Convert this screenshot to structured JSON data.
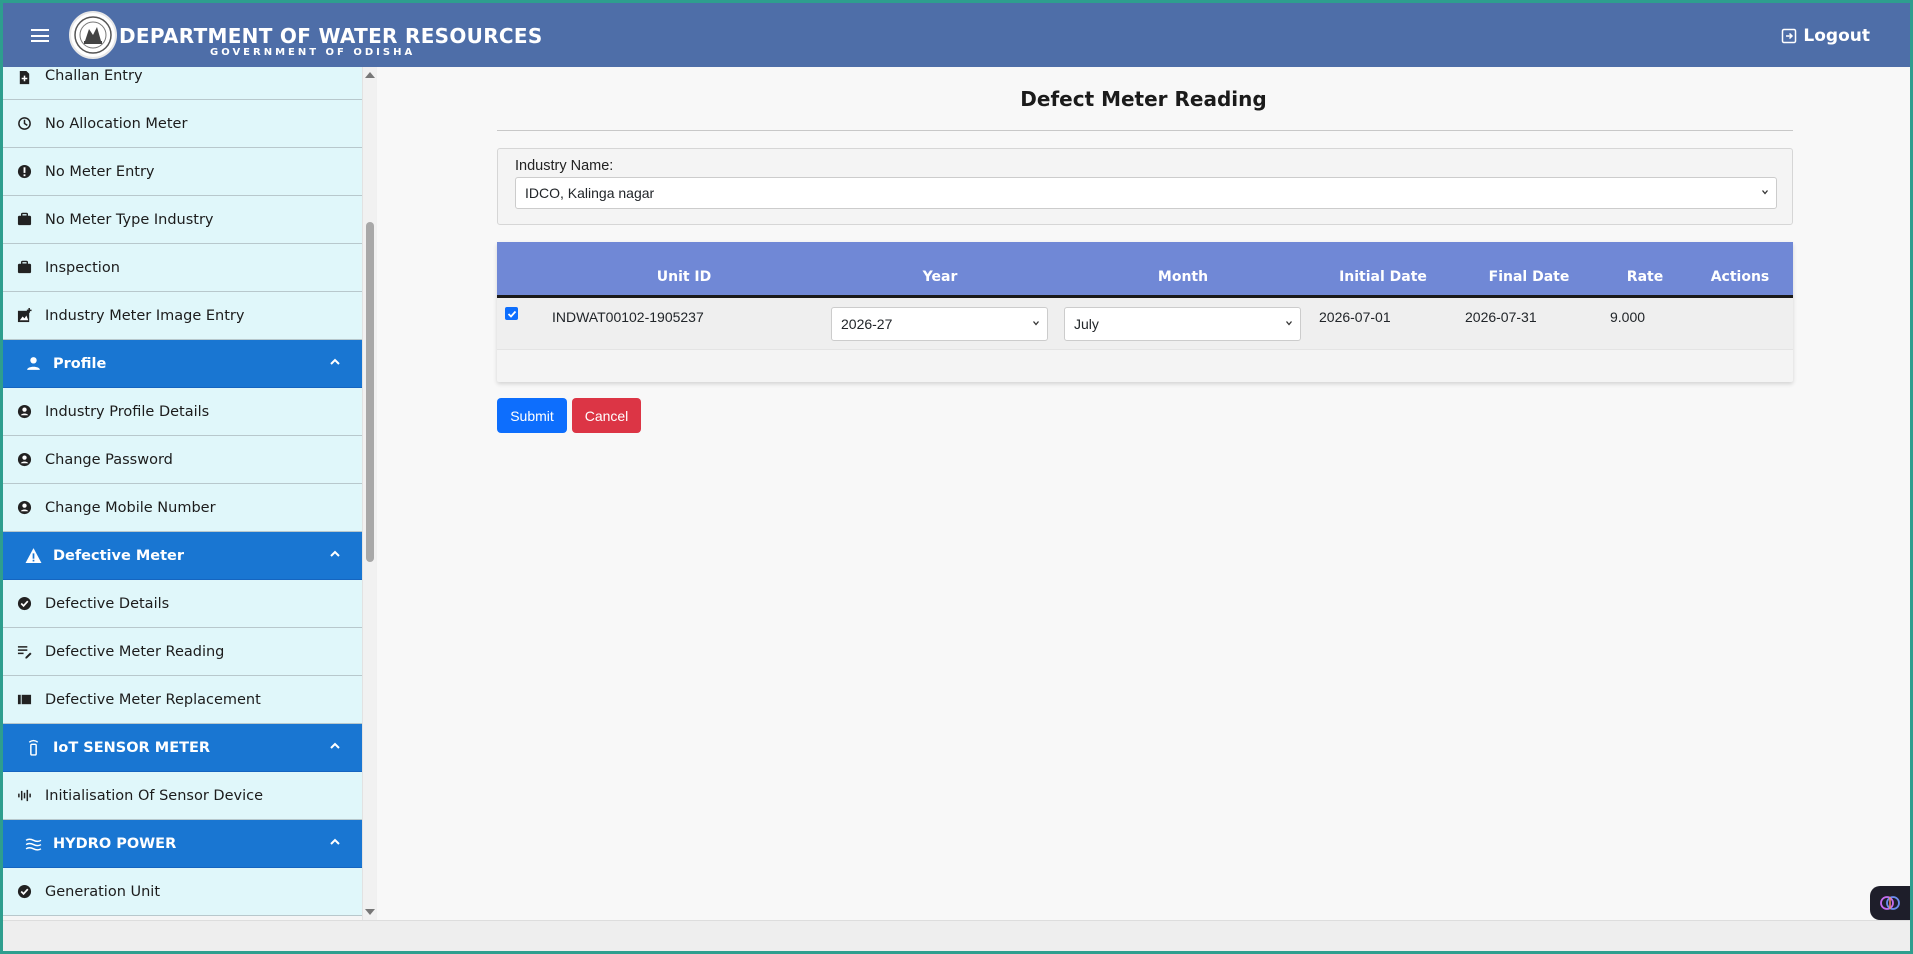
{
  "header": {
    "title": "DEPARTMENT OF WATER RESOURCES",
    "subtitle": "GOVERNMENT OF ODISHA",
    "logout_label": "Logout",
    "bg_color": "#4e6ea8"
  },
  "sidebar": {
    "items": [
      {
        "label": "Challan Entry",
        "icon": "file-plus-icon"
      },
      {
        "label": "No Allocation Meter",
        "icon": "timer-icon"
      },
      {
        "label": "No Meter Entry",
        "icon": "alert-circle-icon"
      },
      {
        "label": "No Meter Type Industry",
        "icon": "briefcase-icon"
      },
      {
        "label": "Inspection",
        "icon": "briefcase-icon"
      },
      {
        "label": "Industry Meter Image Entry",
        "icon": "image-plus-icon"
      },
      {
        "label": "Profile",
        "icon": "person-icon",
        "section": true
      },
      {
        "label": "Industry Profile Details",
        "icon": "account-circle-icon"
      },
      {
        "label": "Change Password",
        "icon": "account-circle-icon"
      },
      {
        "label": "Change Mobile Number",
        "icon": "account-circle-icon"
      },
      {
        "label": "Defective Meter",
        "icon": "warning-icon",
        "section": true
      },
      {
        "label": "Defective Details",
        "icon": "check-circle-icon"
      },
      {
        "label": "Defective Meter Reading",
        "icon": "edit-note-icon"
      },
      {
        "label": "Defective Meter Replacement",
        "icon": "list-icon"
      },
      {
        "label": "IoT SENSOR METER",
        "icon": "sensor-icon",
        "section": true
      },
      {
        "label": "Initialisation Of Sensor Device",
        "icon": "waveform-icon"
      },
      {
        "label": "HYDRO POWER",
        "icon": "waves-icon",
        "section": true
      },
      {
        "label": "Generation Unit",
        "icon": "check-circle-icon"
      }
    ],
    "section_color": "#1976d2",
    "item_bg": "#e0f7fa"
  },
  "main": {
    "title": "Defect Meter Reading",
    "filter": {
      "label": "Industry Name:",
      "selected": "IDCO, Kalinga nagar"
    },
    "table": {
      "header_color": "#7088d6",
      "columns": [
        "Unit ID",
        "Year",
        "Month",
        "Initial Date",
        "Final Date",
        "Rate",
        "Actions"
      ],
      "rows": [
        {
          "checked": true,
          "unit_id": "INDWAT00102-1905237",
          "year": "2026-27",
          "month": "July",
          "initial_date": "2026-07-01",
          "final_date": "2026-07-31",
          "rate": "9.000",
          "actions": ""
        }
      ]
    },
    "buttons": {
      "submit": "Submit",
      "cancel": "Cancel",
      "submit_color": "#0d6efd",
      "cancel_color": "#dc3545"
    }
  }
}
